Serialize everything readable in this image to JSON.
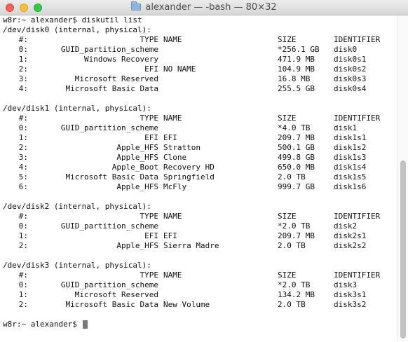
{
  "window": {
    "title": "alexander — -bash — 80×32"
  },
  "terminal": {
    "command_line": "w8r:~ alexander$ diskutil list",
    "prompt": "w8r:~ alexander$ ",
    "headers": {
      "num": "#:",
      "type": "TYPE",
      "name": "NAME",
      "size": "SIZE",
      "id": "IDENTIFIER"
    },
    "disks": [
      {
        "header": "/dev/disk0 (internal, physical):",
        "rows": [
          {
            "num": "0:",
            "type": "GUID_partition_scheme",
            "name": "",
            "size": "*256.1 GB",
            "id": "disk0"
          },
          {
            "num": "1:",
            "type": "Windows Recovery",
            "name": "",
            "size": "471.9 MB",
            "id": "disk0s1"
          },
          {
            "num": "2:",
            "type": "EFI",
            "name": "NO NAME",
            "size": "104.9 MB",
            "id": "disk0s2"
          },
          {
            "num": "3:",
            "type": "Microsoft Reserved",
            "name": "",
            "size": "16.8 MB",
            "id": "disk0s3"
          },
          {
            "num": "4:",
            "type": "Microsoft Basic Data",
            "name": "",
            "size": "255.5 GB",
            "id": "disk0s4"
          }
        ]
      },
      {
        "header": "/dev/disk1 (internal, physical):",
        "rows": [
          {
            "num": "0:",
            "type": "GUID_partition_scheme",
            "name": "",
            "size": "*4.0 TB",
            "id": "disk1"
          },
          {
            "num": "1:",
            "type": "EFI",
            "name": "EFI",
            "size": "209.7 MB",
            "id": "disk1s1"
          },
          {
            "num": "2:",
            "type": "Apple_HFS",
            "name": "Stratton",
            "size": "500.1 GB",
            "id": "disk1s2"
          },
          {
            "num": "3:",
            "type": "Apple_HFS",
            "name": "Clone",
            "size": "499.8 GB",
            "id": "disk1s3"
          },
          {
            "num": "4:",
            "type": "Apple_Boot",
            "name": "Recovery HD",
            "size": "650.0 MB",
            "id": "disk1s4"
          },
          {
            "num": "5:",
            "type": "Microsoft Basic Data",
            "name": "Springfield",
            "size": "2.0 TB",
            "id": "disk1s5"
          },
          {
            "num": "6:",
            "type": "Apple_HFS",
            "name": "McFly",
            "size": "999.7 GB",
            "id": "disk1s6"
          }
        ]
      },
      {
        "header": "/dev/disk2 (internal, physical):",
        "rows": [
          {
            "num": "0:",
            "type": "GUID_partition_scheme",
            "name": "",
            "size": "*2.0 TB",
            "id": "disk2"
          },
          {
            "num": "1:",
            "type": "EFI",
            "name": "EFI",
            "size": "209.7 MB",
            "id": "disk2s1"
          },
          {
            "num": "2:",
            "type": "Apple_HFS",
            "name": "Sierra Madre",
            "size": "2.0 TB",
            "id": "disk2s2"
          }
        ]
      },
      {
        "header": "/dev/disk3 (internal, physical):",
        "rows": [
          {
            "num": "0:",
            "type": "GUID_partition_scheme",
            "name": "",
            "size": "*2.0 TB",
            "id": "disk3"
          },
          {
            "num": "1:",
            "type": "Microsoft Reserved",
            "name": "",
            "size": "134.2 MB",
            "id": "disk3s1"
          },
          {
            "num": "2:",
            "type": "Microsoft Basic Data",
            "name": "New Volume",
            "size": "2.0 TB",
            "id": "disk3s2"
          }
        ]
      }
    ]
  },
  "icons": {
    "title_icon": "folder-icon"
  },
  "colors": {
    "close": "#fc605c",
    "minimize": "#fdbc40",
    "zoom": "#34c84a"
  }
}
